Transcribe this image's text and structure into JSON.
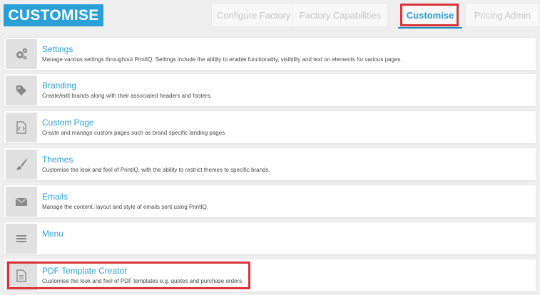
{
  "header": {
    "title": "CUSTOMISE"
  },
  "tabs": [
    {
      "label": "Configure Factory"
    },
    {
      "label": "Factory Capabilities"
    },
    {
      "label": "Customise",
      "active": true
    },
    {
      "label": "Pricing Admin"
    }
  ],
  "colors": {
    "accent": "#2a9fd8",
    "highlight": "#d9343a",
    "icon_bg": "#e1e1e1"
  },
  "items": [
    {
      "icon": "gears-icon",
      "title": "Settings",
      "description": "Manage various settings throughout PrintIQ. Settings include the ability to enable functionality, visibility and text on elements for various pages."
    },
    {
      "icon": "tag-icon",
      "title": "Branding",
      "description": "Create/edit brands along with their associated headers and footers."
    },
    {
      "icon": "code-file-icon",
      "title": "Custom Page",
      "description": "Create and manage custom pages such as brand specific landing pages."
    },
    {
      "icon": "paintbrush-icon",
      "title": "Themes",
      "description": "Customise the look and feel of PrintIQ, with the ability to restrict themes to specific brands."
    },
    {
      "icon": "envelope-icon",
      "title": "Emails",
      "description": "Manage the content, layout and style of emails sent using PrintIQ."
    },
    {
      "icon": "menu-icon",
      "title": "Menu",
      "description": ""
    },
    {
      "icon": "document-icon",
      "title": "PDF Template Creator",
      "description": "Customise the look and feel of PDF templates e.g. quotes and purchase orders"
    }
  ]
}
